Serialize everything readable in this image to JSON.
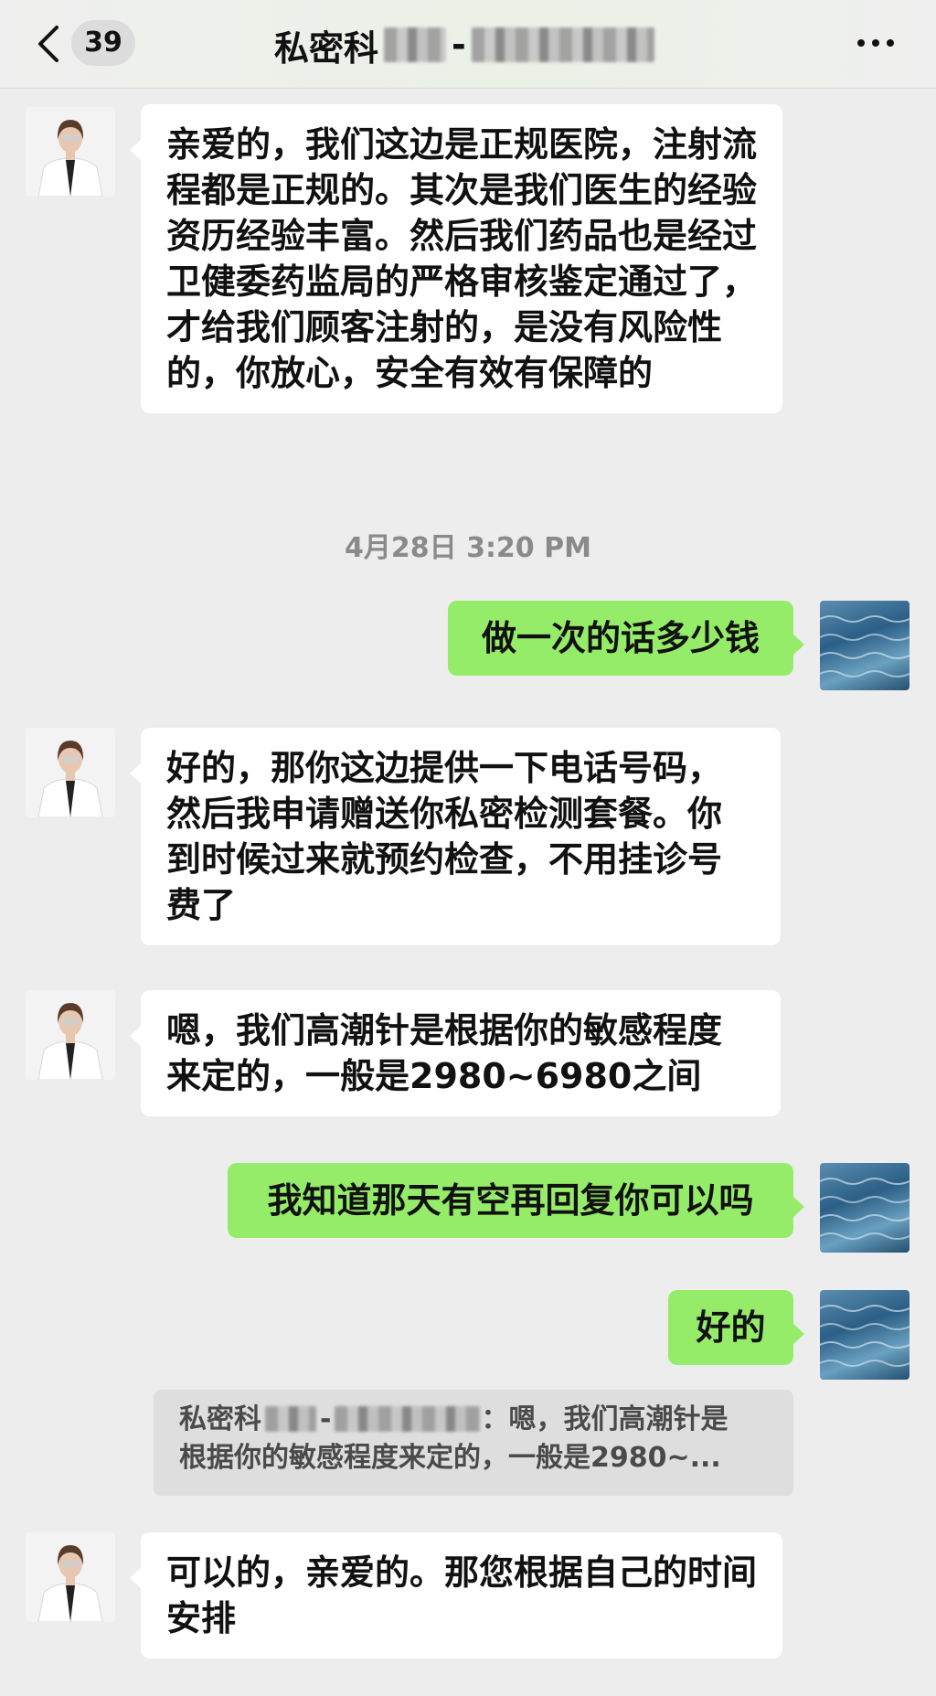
{
  "header": {
    "unread_count": "39",
    "title_prefix": "私密科",
    "title_separator": "-"
  },
  "messages": [
    {
      "side": "in",
      "text": "亲爱的，我们这边是正规医院，注射流程都是正规的。其次是我们医生的经验资历经验丰富。然后我们药品也是经过卫健委药监局的严格审核鉴定通过了，才给我们顾客注射的，是没有风险性的，你放心，安全有效有保障的"
    },
    {
      "side": "out",
      "text": "做一次的话多少钱"
    },
    {
      "side": "in",
      "text": "好的，那你这边提供一下电话号码，然后我申请赠送你私密检测套餐。你到时候过来就预约检查，不用挂诊号费了"
    },
    {
      "side": "in",
      "text": "嗯，我们高潮针是根据你的敏感程度来定的，一般是2980~6980之间"
    },
    {
      "side": "out",
      "text": "我知道那天有空再回复你可以吗"
    },
    {
      "side": "out",
      "text": "好的"
    },
    {
      "side": "in",
      "text": "可以的，亲爱的。那您根据自己的时间安排"
    }
  ],
  "timestamp": "4月28日 3:20 PM",
  "quote": {
    "sender_prefix": "私密科",
    "separator": "-",
    "text_line1": "：嗯，我们高潮针是",
    "text_line2": "根据你的敏感程度来定的，一般是2980~..."
  },
  "colors": {
    "background": "#ededed",
    "outgoing_bubble": "#95ec69",
    "incoming_bubble": "#ffffff"
  },
  "icons": [
    "back-chevron-icon",
    "more-options-icon",
    "doctor-avatar",
    "sea-avatar"
  ]
}
